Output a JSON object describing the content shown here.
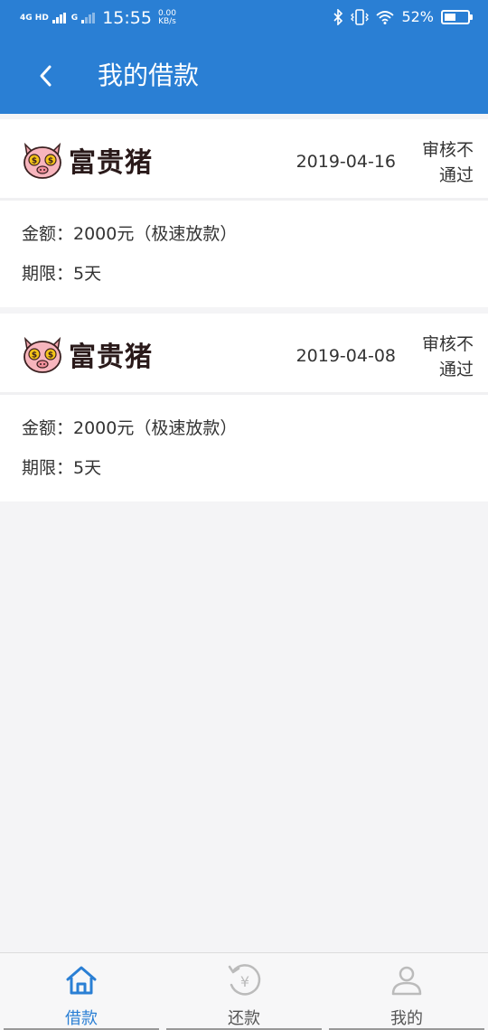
{
  "status_bar": {
    "network": "4G HD",
    "network2": "G",
    "time": "15:55",
    "speed_value": "0.00",
    "speed_unit": "KB/s",
    "battery_percent": "52%",
    "battery_level": 0.52
  },
  "header": {
    "title": "我的借款",
    "back_icon": "chevron-left-icon"
  },
  "loans": [
    {
      "brand": "富贵猪",
      "date": "2019-04-16",
      "status": "审核不通过",
      "amount": "金额：2000元（极速放款）",
      "term": "期限：5天"
    },
    {
      "brand": "富贵猪",
      "date": "2019-04-08",
      "status": "审核不通过",
      "amount": "金额：2000元（极速放款）",
      "term": "期限：5天"
    }
  ],
  "tabs": [
    {
      "label": "借款",
      "icon": "home-icon",
      "active": true
    },
    {
      "label": "还款",
      "icon": "repay-yuan-icon",
      "active": false
    },
    {
      "label": "我的",
      "icon": "user-icon",
      "active": false
    }
  ],
  "colors": {
    "primary": "#2a7fd4",
    "background": "#f4f4f6",
    "card": "#ffffff",
    "brand_pig": "#f4a7b0"
  }
}
